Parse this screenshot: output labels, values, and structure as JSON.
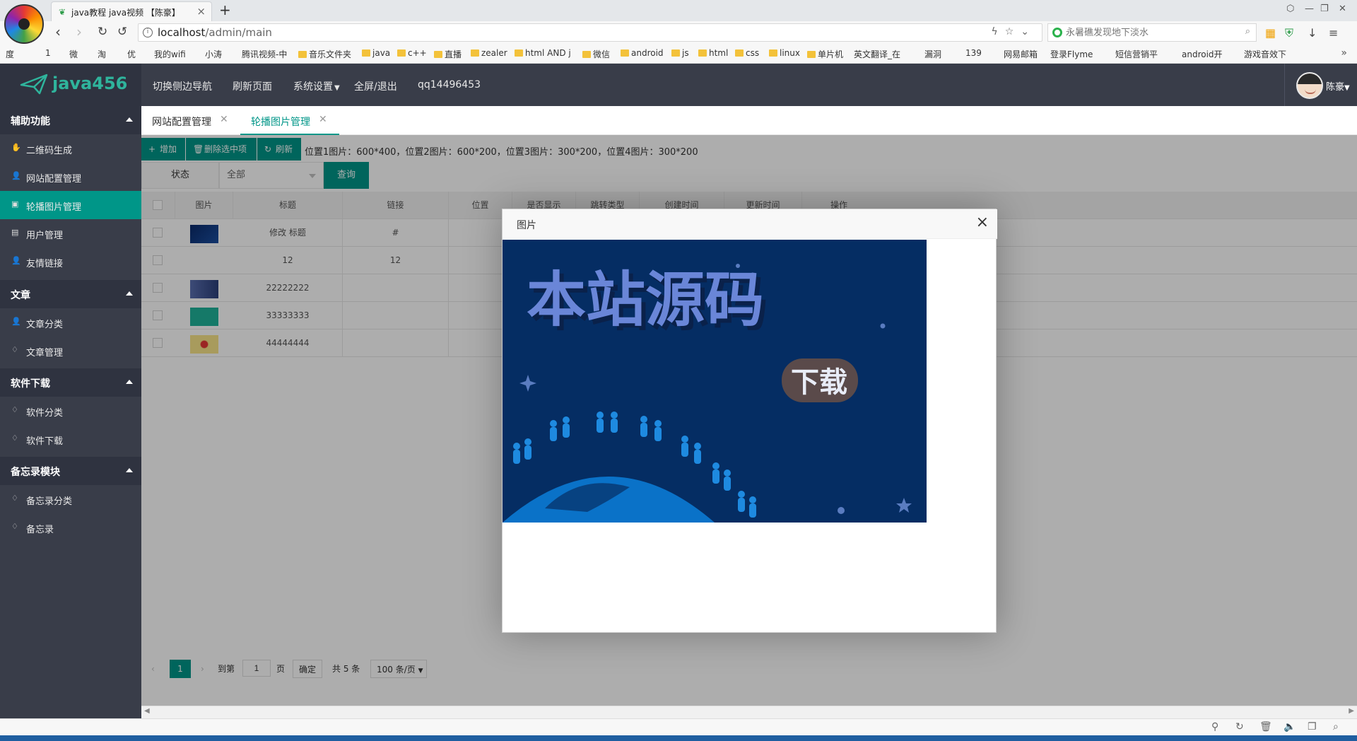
{
  "browser": {
    "tab_title": "java教程 java视频 【陈豪】",
    "url_host": "localhost",
    "url_path": "/admin/main",
    "search_placeholder": "永暑礁发现地下淡水",
    "bookmarks": [
      "度",
      "1",
      "微",
      "淘",
      "优",
      "我的wifi",
      "小涛",
      "腾讯视频-中",
      "音乐文件夹",
      "java",
      "c++",
      "直播",
      "zealer",
      "html AND j",
      "微信",
      "android",
      "js",
      "html",
      "css",
      "linux",
      "单片机",
      "英文翻译_在",
      "漏洞",
      "139",
      "网易邮箱",
      "登录Flyme",
      "短信营销平",
      "android开",
      "游戏音效下"
    ]
  },
  "app": {
    "logo": "java456",
    "nav": [
      "切换侧边导航",
      "刷新页面",
      "系统设置",
      "全屏/退出",
      "qq14496453"
    ],
    "user": "陈豪"
  },
  "sidebar": {
    "groups": [
      {
        "title": "辅助功能",
        "items": [
          {
            "icon": "qrcode-icon",
            "label": "二维码生成"
          },
          {
            "icon": "user-icon",
            "label": "网站配置管理"
          },
          {
            "icon": "image-icon",
            "label": "轮播图片管理",
            "active": true
          },
          {
            "icon": "clipboard-icon",
            "label": "用户管理"
          },
          {
            "icon": "user-icon",
            "label": "友情链接"
          }
        ]
      },
      {
        "title": "文章",
        "items": [
          {
            "icon": "user-icon",
            "label": "文章分类"
          },
          {
            "icon": "diamond-icon",
            "label": "文章管理"
          }
        ]
      },
      {
        "title": "软件下载",
        "items": [
          {
            "icon": "diamond-icon",
            "label": "软件分类"
          },
          {
            "icon": "diamond-icon",
            "label": "软件下载"
          }
        ]
      },
      {
        "title": "备忘录模块",
        "items": [
          {
            "icon": "diamond-icon",
            "label": "备忘录分类"
          },
          {
            "icon": "diamond-icon",
            "label": "备忘录"
          }
        ]
      }
    ]
  },
  "tabs": [
    {
      "label": "网站配置管理",
      "active": false
    },
    {
      "label": "轮播图片管理",
      "active": true
    }
  ],
  "toolbar": {
    "add": "增加",
    "delete": "删除选中项",
    "refresh": "刷新",
    "note": "位置1图片：600*400，位置2图片：600*200，位置3图片：300*200，位置4图片：300*200"
  },
  "filter": {
    "label": "状态",
    "value": "全部",
    "query": "查询"
  },
  "table": {
    "headers": [
      "图片",
      "标题",
      "链接",
      "位置",
      "是否显示",
      "跳转类型",
      "创建时间",
      "更新时间",
      "操作"
    ],
    "rows": [
      {
        "title": "修改 标题",
        "link": "#"
      },
      {
        "title": "12",
        "link": "12"
      },
      {
        "title": "22222222",
        "link": ""
      },
      {
        "title": "33333333",
        "link": ""
      },
      {
        "title": "44444444",
        "link": ""
      }
    ]
  },
  "pager": {
    "current": "1",
    "goto": "到第",
    "page_input": "1",
    "page_unit": "页",
    "ok": "确定",
    "total": "共 5 条",
    "size": "100 条/页"
  },
  "modal": {
    "title": "图片",
    "image_text": "本站源码",
    "image_badge": "下载"
  },
  "colors": {
    "accent": "#009688",
    "header": "#393d49",
    "sidebar": "#393d49",
    "group": "#2f3340",
    "banner_bg": "#052d63"
  }
}
